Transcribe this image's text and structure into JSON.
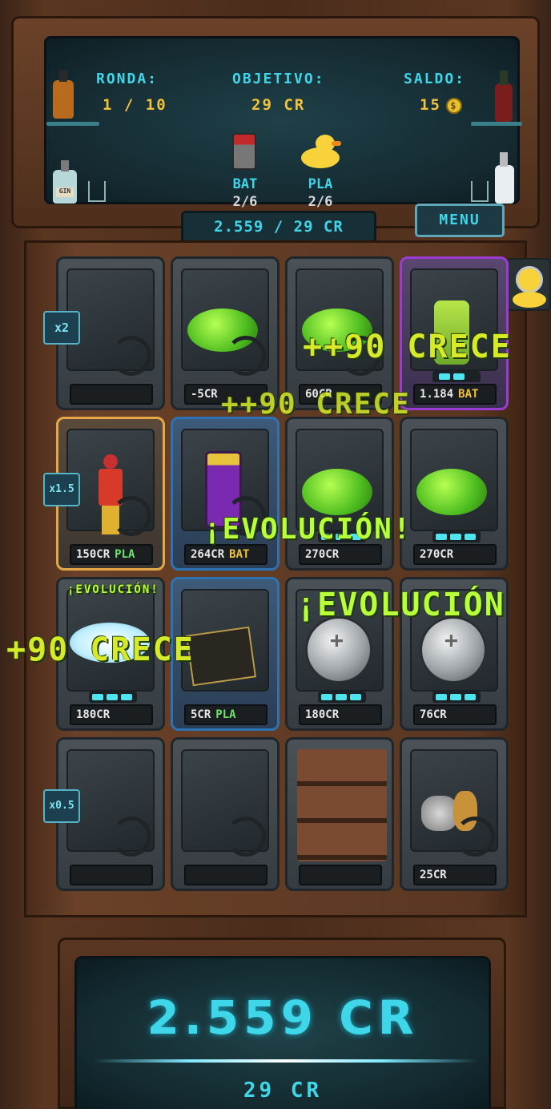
{
  "hud": {
    "round_label": "RONDA:",
    "round_value": "1 / 10",
    "target_label": "OBJETIVO:",
    "target_value": "29 CR",
    "balance_label": "SALDO:",
    "balance_value": "15",
    "coin_symbol": "$",
    "bat_label": "BAT",
    "bat_value": "2/6",
    "pla_label": "PLA",
    "pla_value": "2/6",
    "gin_label": "GIN"
  },
  "score_bar": "2.559 / 29 CR",
  "menu_label": "MENU",
  "multipliers": [
    "x2",
    "x1.5",
    "x0.5"
  ],
  "slots": [
    {
      "price": "",
      "tag": "",
      "tag_type": ""
    },
    {
      "price": "-5CR",
      "tag": "",
      "tag_type": ""
    },
    {
      "price": "60CR",
      "tag": "",
      "tag_type": ""
    },
    {
      "price": "1.184",
      "tag": "BAT",
      "tag_type": "bat"
    },
    {
      "price": "150CR",
      "tag": "PLA",
      "tag_type": "pla"
    },
    {
      "price": "264CR",
      "tag": "BAT",
      "tag_type": "bat"
    },
    {
      "price": "270CR",
      "tag": "",
      "tag_type": ""
    },
    {
      "price": "270CR",
      "tag": "",
      "tag_type": ""
    },
    {
      "price": "180CR",
      "tag": "",
      "tag_type": ""
    },
    {
      "price": "5CR",
      "tag": "PLA",
      "tag_type": "pla"
    },
    {
      "price": "180CR",
      "tag": "",
      "tag_type": ""
    },
    {
      "price": "76CR",
      "tag": "",
      "tag_type": ""
    },
    {
      "price": "",
      "tag": "",
      "tag_type": ""
    },
    {
      "price": "",
      "tag": "",
      "tag_type": ""
    },
    {
      "price": "",
      "tag": "",
      "tag_type": ""
    },
    {
      "price": "25CR",
      "tag": "",
      "tag_type": ""
    }
  ],
  "floating_texts": {
    "grow_a": "++90 CRECE",
    "grow_b": "++90 CRECE",
    "grow_c": "+90 CRECE",
    "evolution_a": "¡EVOLUCIÓN!",
    "evolution_b": "¡EVOLUCIÓN",
    "evolution_small": "¡EVOLUCIÓN!"
  },
  "total": "2.559 CR",
  "goal": "29 CR",
  "colors": {
    "accent": "#3ed6e8",
    "gold": "#f2c23a",
    "pla": "#6ee26a",
    "bat": "#f0c33c"
  }
}
